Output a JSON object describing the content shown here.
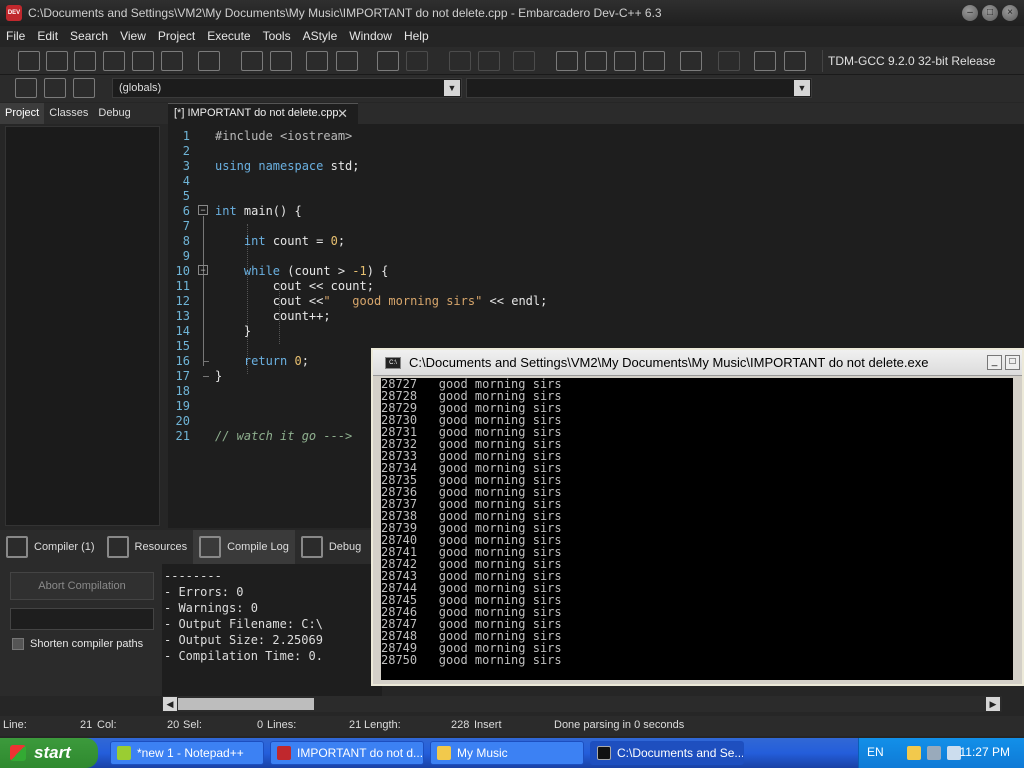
{
  "window": {
    "title": "C:\\Documents and Settings\\VM2\\My Documents\\My Music\\IMPORTANT do not delete.cpp - Embarcadero Dev-C++ 6.3",
    "app_icon_label": "DEV"
  },
  "menu": [
    "File",
    "Edit",
    "Search",
    "View",
    "Project",
    "Execute",
    "Tools",
    "AStyle",
    "Window",
    "Help"
  ],
  "toolbar": {
    "compiler": "TDM-GCC 9.2.0 32-bit Release",
    "scope": "(globals)"
  },
  "left_tabs": [
    "Project",
    "Classes",
    "Debug"
  ],
  "editor": {
    "tab_label": "[*] IMPORTANT do not delete.cpp",
    "line_numbers": [
      "1",
      "2",
      "3",
      "4",
      "5",
      "6",
      "7",
      "8",
      "9",
      "10",
      "11",
      "12",
      "13",
      "14",
      "15",
      "16",
      "17",
      "18",
      "19",
      "20",
      "21"
    ]
  },
  "bottom_tabs": [
    "Compiler (1)",
    "Resources",
    "Compile Log",
    "Debug"
  ],
  "compile": {
    "abort_label": "Abort Compilation",
    "shorten_label": "Shorten compiler paths",
    "log": [
      "--------",
      "- Errors: 0",
      "- Warnings: 0",
      "- Output Filename: C:\\",
      "- Output Size: 2.25069",
      "- Compilation Time: 0."
    ]
  },
  "status": {
    "line_label": "Line:",
    "line_value": "21",
    "col_label": "Col:",
    "col_value": "20",
    "sel_label": "Sel:",
    "sel_value": "0",
    "lines_label": "Lines:",
    "lines_value": "21",
    "length_label": "Length:",
    "length_value": "228",
    "mode": "Insert",
    "parse_message": "Done parsing in 0 seconds"
  },
  "console": {
    "title": "C:\\Documents and Settings\\VM2\\My Documents\\My Music\\IMPORTANT do not delete.exe",
    "lines": [
      "28727   good morning sirs",
      "28728   good morning sirs",
      "28729   good morning sirs",
      "28730   good morning sirs",
      "28731   good morning sirs",
      "28732   good morning sirs",
      "28733   good morning sirs",
      "28734   good morning sirs",
      "28735   good morning sirs",
      "28736   good morning sirs",
      "28737   good morning sirs",
      "28738   good morning sirs",
      "28739   good morning sirs",
      "28740   good morning sirs",
      "28741   good morning sirs",
      "28742   good morning sirs",
      "28743   good morning sirs",
      "28744   good morning sirs",
      "28745   good morning sirs",
      "28746   good morning sirs",
      "28747   good morning sirs",
      "28748   good morning sirs",
      "28749   good morning sirs",
      "28750   good morning sirs"
    ]
  },
  "taskbar": {
    "start_label": "start",
    "tasks": [
      "*new 1 - Notepad++",
      "IMPORTANT do not d...",
      "My Music",
      "C:\\Documents and Se..."
    ],
    "clock": "11:27 PM",
    "lang": "EN"
  }
}
